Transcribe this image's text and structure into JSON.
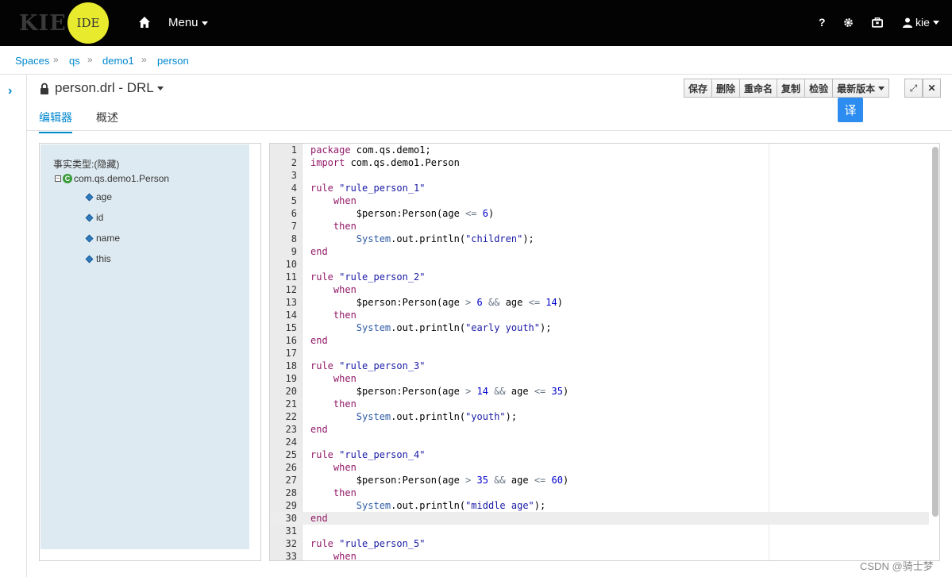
{
  "app": {
    "logo_kie": "KIE",
    "logo_ide": "IDE",
    "menu_label": "Menu",
    "help": "?",
    "user": "kie"
  },
  "breadcrumb": [
    "Spaces",
    "qs",
    "demo1",
    "person"
  ],
  "editor_title": "person.drl - DRL",
  "toolbar": {
    "save": "保存",
    "delete": "删除",
    "rename": "重命名",
    "copy": "复制",
    "validate": "检验",
    "latest": "最新版本"
  },
  "translate_label": "译",
  "tabs": [
    "编辑器",
    "概述"
  ],
  "fact_panel": {
    "title": "事实类型:(隐藏)",
    "type": "com.qs.demo1.Person",
    "fields": [
      "age",
      "id",
      "name",
      "this"
    ]
  },
  "code_lines": [
    "package com.qs.demo1;",
    "import com.qs.demo1.Person",
    "",
    "rule \"rule_person_1\"",
    "    when",
    "        $person:Person(age <= 6)",
    "    then",
    "        System.out.println(\"children\");",
    "end",
    "",
    "rule \"rule_person_2\"",
    "    when",
    "        $person:Person(age > 6 && age <= 14)",
    "    then",
    "        System.out.println(\"early youth\");",
    "end",
    "",
    "rule \"rule_person_3\"",
    "    when",
    "        $person:Person(age > 14 && age <= 35)",
    "    then",
    "        System.out.println(\"youth\");",
    "end",
    "",
    "rule \"rule_person_4\"",
    "    when",
    "        $person:Person(age > 35 && age <= 60)",
    "    then",
    "        System.out.println(\"middle age\");",
    "end",
    "",
    "rule \"rule_person_5\"",
    "    when"
  ],
  "active_line": 30,
  "watermark": "CSDN @骑士梦",
  "colors": {
    "accent": "#0088ce",
    "topbar": "#030303",
    "ide_logo": "#e8ea2e",
    "translate": "#2d8cf0"
  }
}
